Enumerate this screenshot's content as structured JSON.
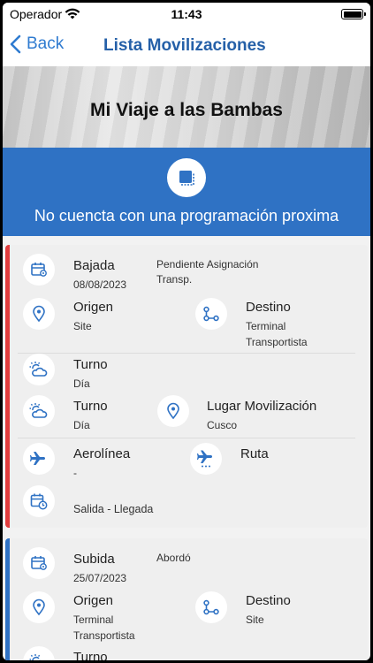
{
  "status_bar": {
    "carrier": "Operador",
    "time": "11:43"
  },
  "nav": {
    "back_label": "Back",
    "title": "Lista Movilizaciones"
  },
  "hero": {
    "title": "Mi Viaje a las Bambas"
  },
  "banner": {
    "message": "No cuencta con una programación proxima"
  },
  "colors": {
    "accent": "#2f72c4",
    "nav_title": "#2560a8",
    "stripe_red": "#e03c3c",
    "stripe_blue": "#2f72c4"
  },
  "trips": [
    {
      "tipo": "Bajada",
      "fecha": "08/08/2023",
      "estado_line1": "Pendiente Asignación",
      "estado_line2": "Transp.",
      "origen_label": "Origen",
      "origen": "Site",
      "destino_label": "Destino",
      "destino_line1": "Terminal",
      "destino_line2": "Transportista",
      "turno_label": "Turno",
      "turno": "Día",
      "lugar_label": "Lugar Movilización",
      "lugar": "Cusco",
      "aerolinea_label": "Aerolínea",
      "aerolinea": "-",
      "ruta_label": "Ruta",
      "salida_llegada": "Salida  - Llegada"
    },
    {
      "tipo": "Subida",
      "fecha": "25/07/2023",
      "estado_line1": "Abordó",
      "origen_label": "Origen",
      "origen_line1": "Terminal",
      "origen_line2": "Transportista",
      "destino_label": "Destino",
      "destino": "Site",
      "turno_label": "Turno"
    }
  ]
}
